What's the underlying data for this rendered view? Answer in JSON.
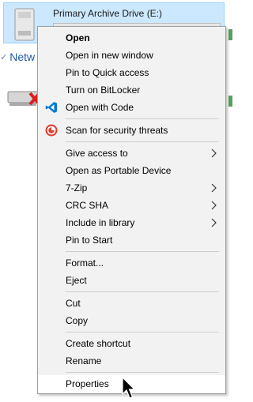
{
  "explorer": {
    "drive_title": "Primary Archive Drive (E:)",
    "network_label": "Netw",
    "network_check": "✓"
  },
  "menu": {
    "items": [
      {
        "label": "Open",
        "bold": true
      },
      {
        "label": "Open in new window"
      },
      {
        "label": "Pin to Quick access"
      },
      {
        "label": "Turn on BitLocker"
      },
      {
        "label": "Open with Code",
        "icon": "vscode-icon"
      },
      {
        "label": "Scan for security threats",
        "icon": "defender-icon"
      },
      {
        "label": "Give access to",
        "submenu": true
      },
      {
        "label": "Open as Portable Device"
      },
      {
        "label": "7-Zip",
        "submenu": true
      },
      {
        "label": "CRC SHA",
        "submenu": true
      },
      {
        "label": "Include in library",
        "submenu": true
      },
      {
        "label": "Pin to Start"
      },
      {
        "label": "Format..."
      },
      {
        "label": "Eject"
      },
      {
        "label": "Cut"
      },
      {
        "label": "Copy"
      },
      {
        "label": "Create shortcut"
      },
      {
        "label": "Rename"
      },
      {
        "label": "Properties",
        "hovered": true
      }
    ]
  },
  "colors": {
    "selection_bg": "#cce8ff",
    "menu_bg": "#f2f2f2",
    "vscode_blue": "#0078d4",
    "defender_red": "#e03c31"
  }
}
